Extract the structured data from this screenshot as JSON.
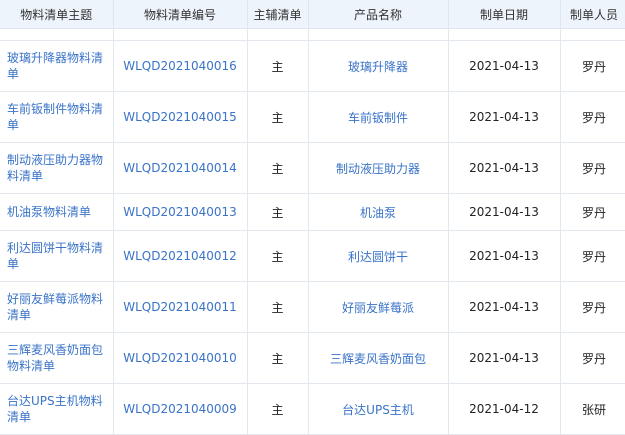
{
  "columns": [
    "物料清单主题",
    "物料清单编号",
    "主辅清单",
    "产品名称",
    "制单日期",
    "制单人员"
  ],
  "rows": [
    {
      "topic": "玻璃升降器物料清单",
      "code": "WLQD2021040016",
      "type": "主",
      "product": "玻璃升降器",
      "date": "2021-04-13",
      "maker": "罗丹"
    },
    {
      "topic": "车前钣制件物料清单",
      "code": "WLQD2021040015",
      "type": "主",
      "product": "车前钣制件",
      "date": "2021-04-13",
      "maker": "罗丹"
    },
    {
      "topic": "制动液压助力器物料清单",
      "code": "WLQD2021040014",
      "type": "主",
      "product": "制动液压助力器",
      "date": "2021-04-13",
      "maker": "罗丹"
    },
    {
      "topic": "机油泵物料清单",
      "code": "WLQD2021040013",
      "type": "主",
      "product": "机油泵",
      "date": "2021-04-13",
      "maker": "罗丹"
    },
    {
      "topic": "利达圆饼干物料清单",
      "code": "WLQD2021040012",
      "type": "主",
      "product": "利达圆饼干",
      "date": "2021-04-13",
      "maker": "罗丹"
    },
    {
      "topic": "好丽友鲜莓派物料清单",
      "code": "WLQD2021040011",
      "type": "主",
      "product": "好丽友鲜莓派",
      "date": "2021-04-13",
      "maker": "罗丹"
    },
    {
      "topic": "三辉麦风香奶面包物料清单",
      "code": "WLQD2021040010",
      "type": "主",
      "product": "三辉麦风香奶面包",
      "date": "2021-04-13",
      "maker": "罗丹"
    },
    {
      "topic": "台达UPS主机物料清单",
      "code": "WLQD2021040009",
      "type": "主",
      "product": "台达UPS主机",
      "date": "2021-04-12",
      "maker": "张研"
    }
  ]
}
